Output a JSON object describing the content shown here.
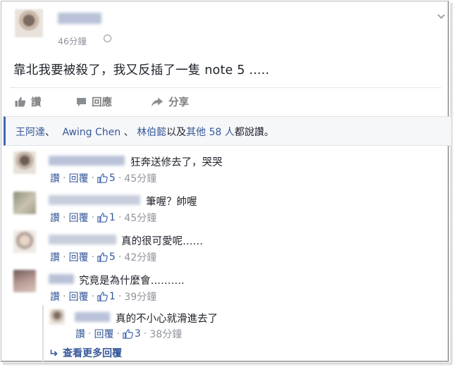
{
  "post": {
    "time": "46分鐘",
    "text": "靠北我要被殺了，我又反插了一隻 note 5 .....",
    "actions": {
      "like": "讚",
      "comment": "回應",
      "share": "分享"
    }
  },
  "likes": {
    "name1": "王阿達",
    "sep1": "、",
    "name2": "Awing Chen",
    "sep2": " 、",
    "name3": "林伯懿",
    "and": "以及",
    "others": "其他 58 人",
    "suffix": "都說讚。"
  },
  "comments": [
    {
      "text": "狂奔送修去了，哭哭",
      "like": "讚",
      "reply": "回覆",
      "count": "5",
      "time": "45分鐘"
    },
    {
      "text": "筆喔？帥喔",
      "like": "讚",
      "reply": "回覆",
      "count": "1",
      "time": "45分鐘"
    },
    {
      "text": "真的很可愛呢……",
      "like": "讚",
      "reply": "回覆",
      "count": "5",
      "time": "42分鐘"
    },
    {
      "text": "究竟是為什麼會……….",
      "like": "讚",
      "reply": "回覆",
      "count": "1",
      "time": "39分鐘"
    }
  ],
  "reply": {
    "text": "真的不小心就滑進去了",
    "like": "讚",
    "reply": "回覆",
    "count": "3",
    "time": "38分鐘"
  },
  "more_replies": "查看更多回覆",
  "meta_sep": "·",
  "colors": {
    "link": "#365899",
    "muted": "#90949c",
    "accent_bar": "#4267b2"
  },
  "icons": [
    "globe-icon",
    "chevron-down-icon",
    "thumb-up-icon",
    "comment-icon",
    "share-arrow-icon",
    "reply-arrow-icon"
  ]
}
